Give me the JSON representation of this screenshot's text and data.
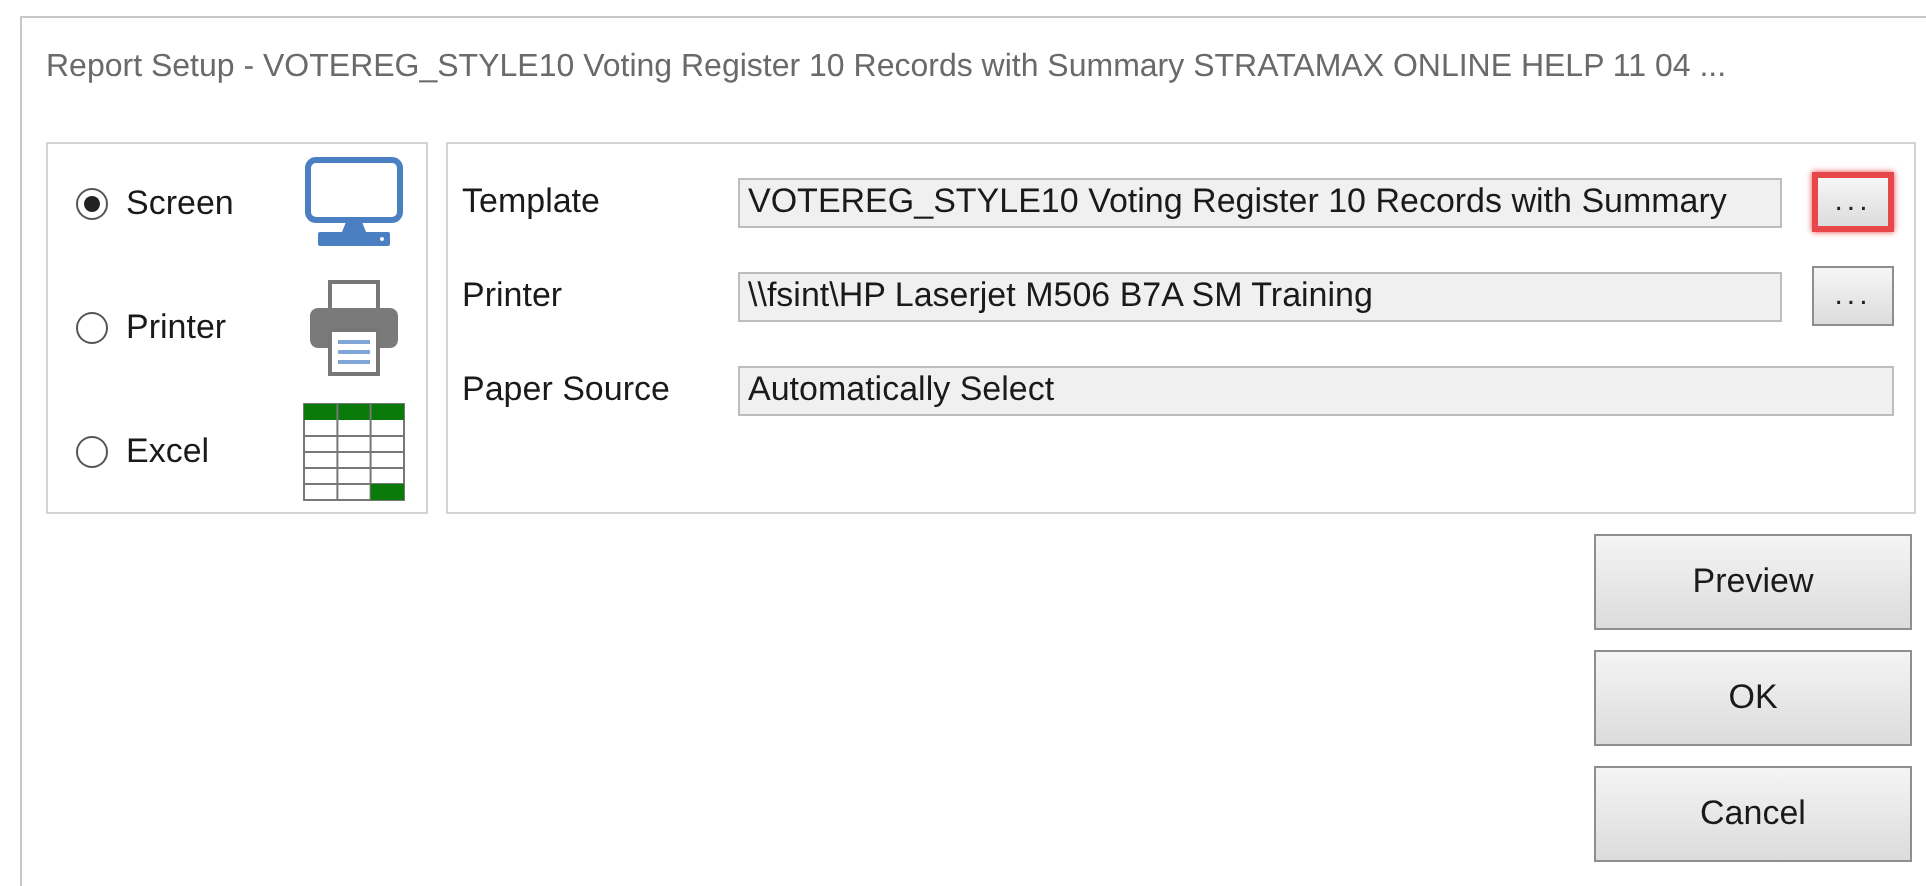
{
  "window": {
    "title": "Report Setup - VOTEREG_STYLE10 Voting Register 10 Records with Summary STRATAMAX ONLINE HELP 11 04 ..."
  },
  "output_options": [
    {
      "label": "Screen",
      "kind": "screen",
      "selected": true
    },
    {
      "label": "Printer",
      "kind": "printer",
      "selected": false
    },
    {
      "label": "Excel",
      "kind": "excel",
      "selected": false
    }
  ],
  "fields": [
    {
      "label": "Template",
      "value": "VOTEREG_STYLE10 Voting Register 10 Records with Summary",
      "browse": "...",
      "highlighted": true
    },
    {
      "label": "Printer",
      "value": "\\\\fsint\\HP Laserjet M506 B7A SM Training",
      "browse": "...",
      "highlighted": false
    },
    {
      "label": "Paper Source",
      "value": "Automatically Select"
    }
  ],
  "buttons": [
    "Preview",
    "OK",
    "Cancel"
  ]
}
